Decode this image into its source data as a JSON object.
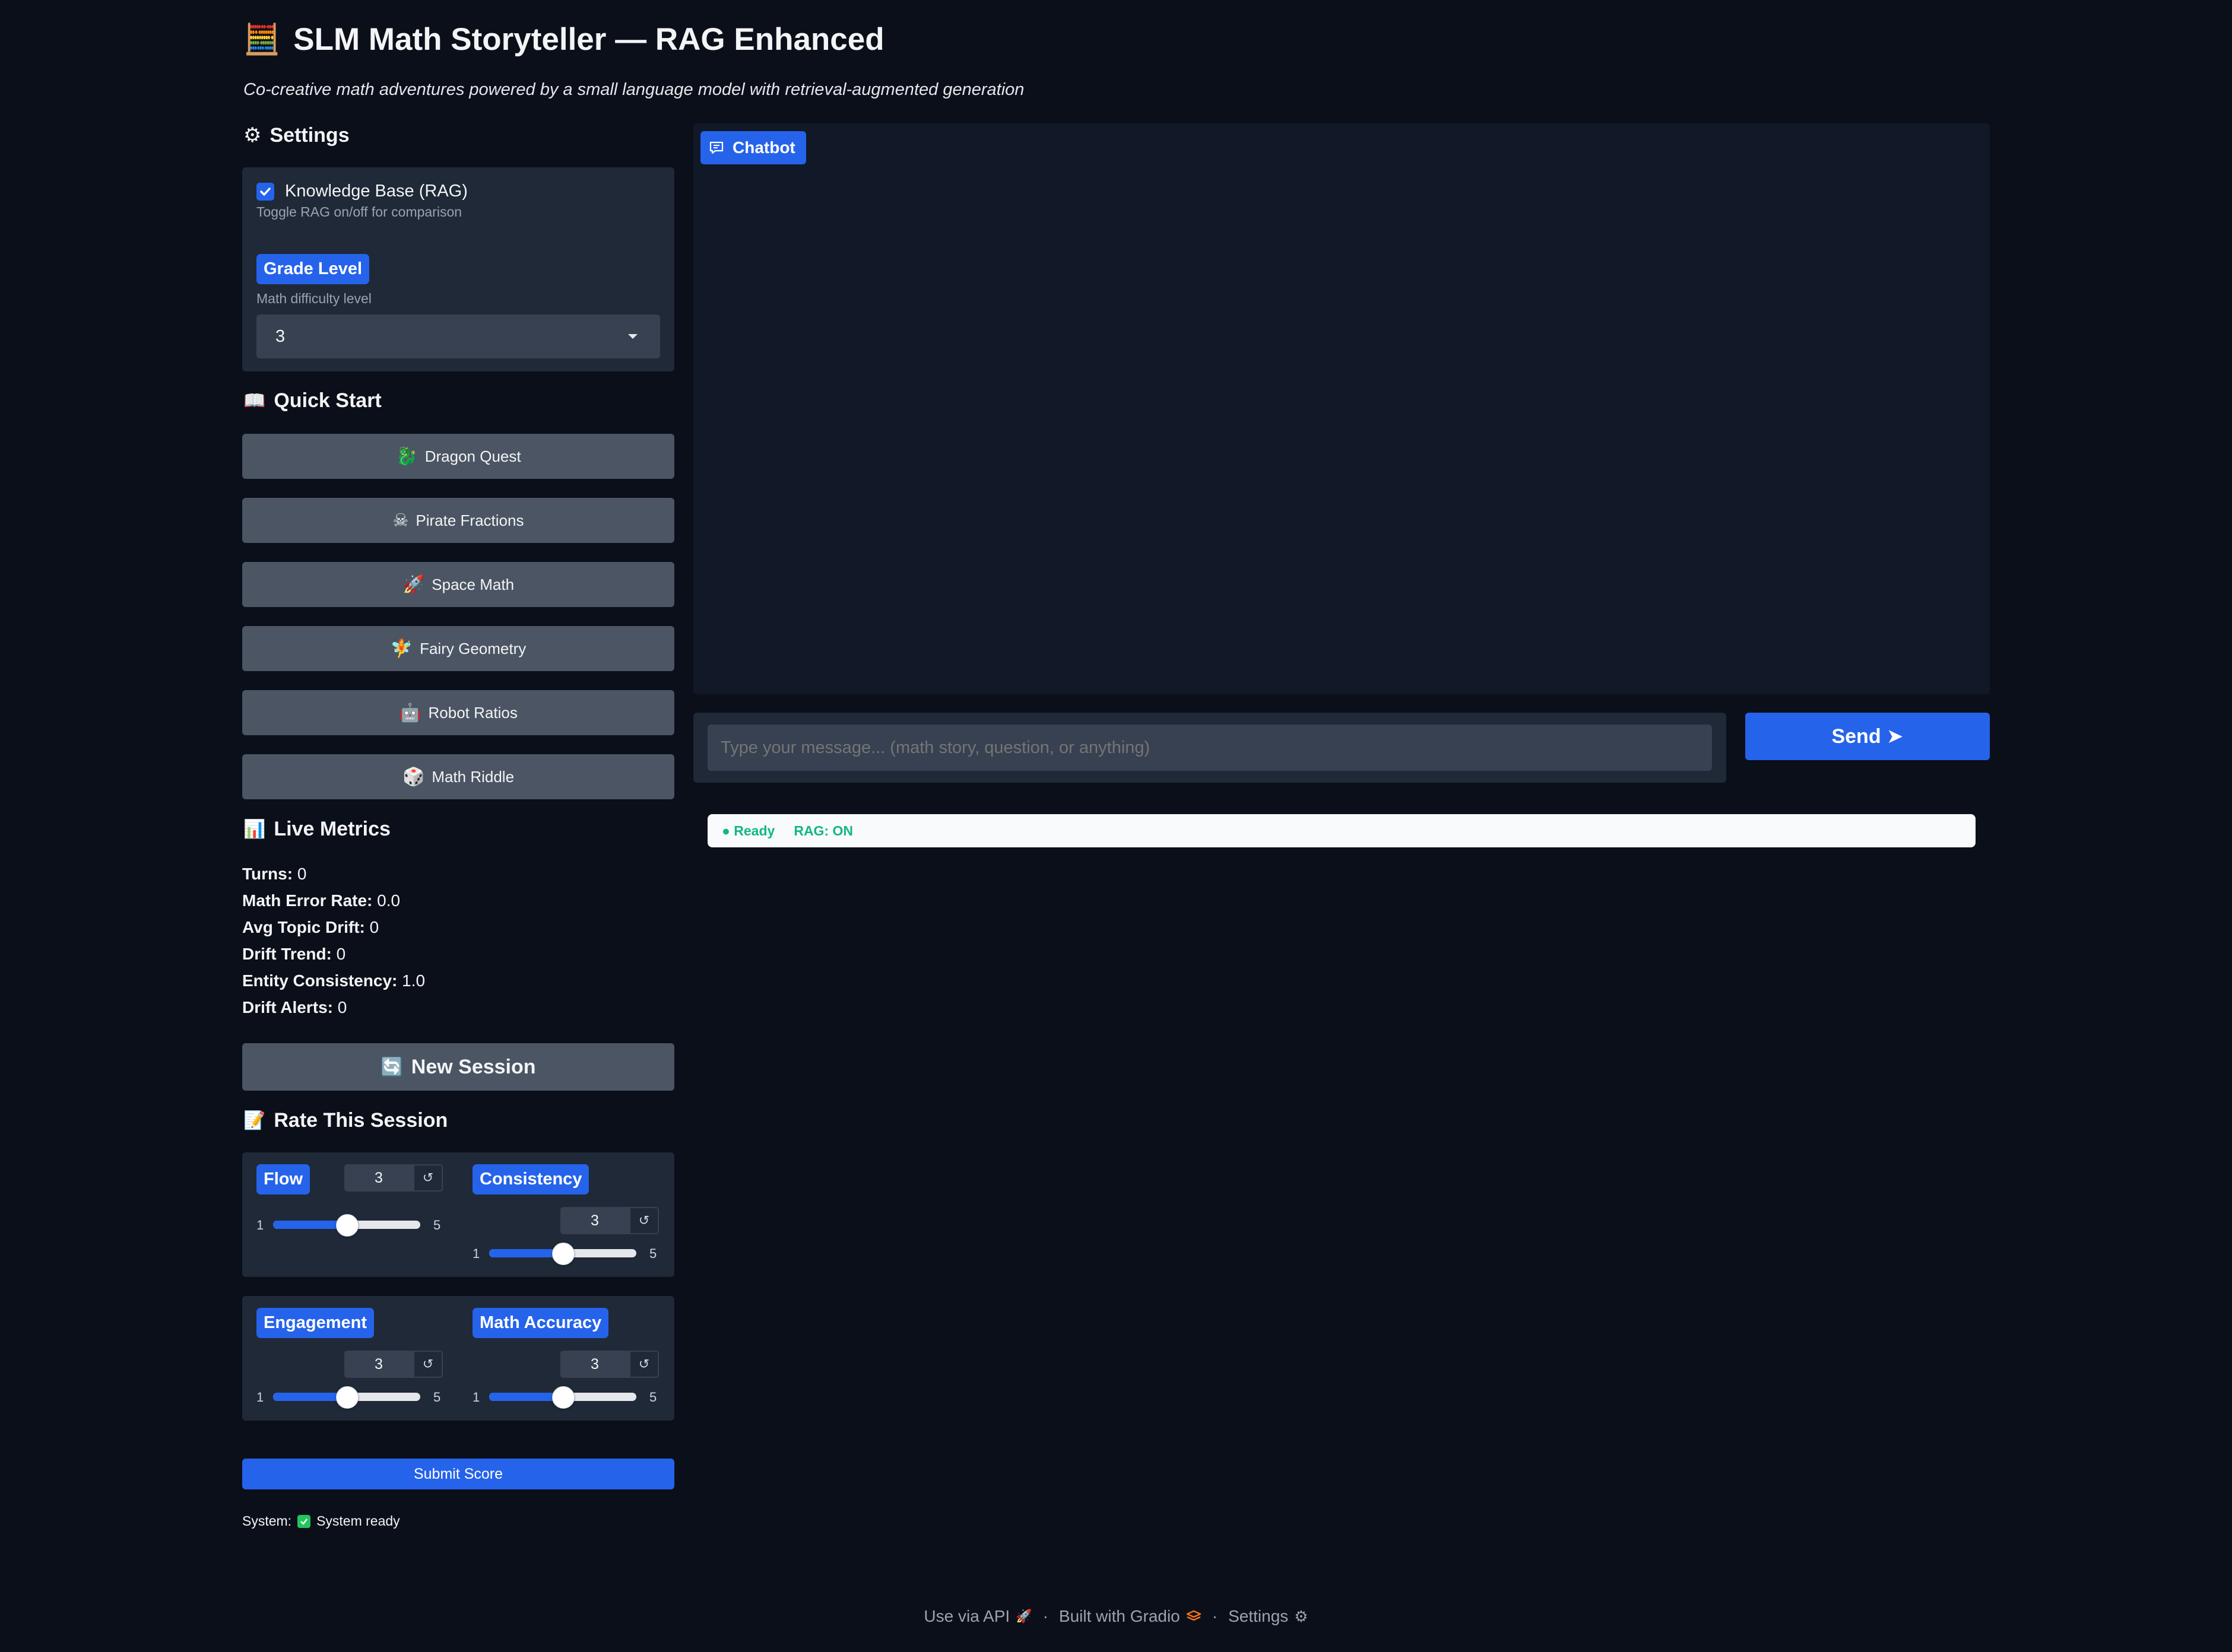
{
  "header": {
    "title_icon": "abacus-icon",
    "title": "SLM Math Storyteller — RAG Enhanced",
    "subtitle": "Co-creative math adventures powered by a small language model with retrieval-augmented generation"
  },
  "settings": {
    "heading": "Settings",
    "rag_label": "Knowledge Base (RAG)",
    "rag_checked": true,
    "rag_hint": "Toggle RAG on/off for comparison",
    "grade_label": "Grade Level",
    "grade_hint": "Math difficulty level",
    "grade_value": "3"
  },
  "quick_start": {
    "heading": "Quick Start",
    "items": [
      {
        "icon": "🐉",
        "label": "Dragon Quest"
      },
      {
        "icon": "☠",
        "label": "Pirate Fractions"
      },
      {
        "icon": "🚀",
        "label": "Space Math"
      },
      {
        "icon": "🧚",
        "label": "Fairy Geometry"
      },
      {
        "icon": "🤖",
        "label": "Robot Ratios"
      },
      {
        "icon": "🎲",
        "label": "Math Riddle"
      }
    ]
  },
  "metrics": {
    "heading": "Live Metrics",
    "items": [
      {
        "label": "Turns:",
        "value": "0"
      },
      {
        "label": "Math Error Rate:",
        "value": "0.0"
      },
      {
        "label": "Avg Topic Drift:",
        "value": "0"
      },
      {
        "label": "Drift Trend:",
        "value": "0"
      },
      {
        "label": "Entity Consistency:",
        "value": "1.0"
      },
      {
        "label": "Drift Alerts:",
        "value": "0"
      }
    ]
  },
  "new_session_label": "New Session",
  "rating": {
    "heading": "Rate This Session",
    "sliders": [
      {
        "label": "Flow",
        "value": "3",
        "min": "1",
        "max": "5",
        "fraction": 0.5
      },
      {
        "label": "Consistency",
        "value": "3",
        "min": "1",
        "max": "5",
        "fraction": 0.5
      },
      {
        "label": "Engagement",
        "value": "3",
        "min": "1",
        "max": "5",
        "fraction": 0.5
      },
      {
        "label": "Math Accuracy",
        "value": "3",
        "min": "1",
        "max": "5",
        "fraction": 0.5
      }
    ],
    "submit_label": "Submit Score"
  },
  "system": {
    "label": "System:",
    "status": "System ready"
  },
  "chat": {
    "label": "Chatbot",
    "input_placeholder": "Type your message... (math story, question, or anything)",
    "send_label": "Send ➤",
    "status_ready": "● Ready",
    "status_rag": "RAG: ON",
    "status_color": "#10b981"
  },
  "footer": {
    "api": "Use via API",
    "built": "Built with Gradio",
    "settings": "Settings",
    "sep": "·"
  },
  "colors": {
    "background": "#0b0f19",
    "panel": "#1f2937",
    "accent": "#2563eb",
    "button": "#4b5563"
  }
}
